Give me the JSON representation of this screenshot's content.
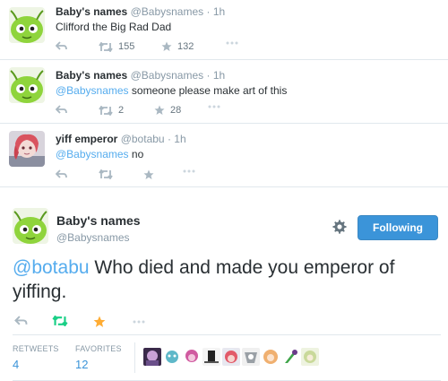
{
  "tweets": [
    {
      "name": "Baby's names",
      "handle": "@Babysnames",
      "dot": "·",
      "time": "1h",
      "mention": "",
      "text": "Clifford the Big Rad Dad",
      "retweets": "155",
      "favorites": "132"
    },
    {
      "name": "Baby's names",
      "handle": "@Babysnames",
      "dot": "·",
      "time": "1h",
      "mention": "@Babysnames",
      "text": " someone please make art of this",
      "retweets": "2",
      "favorites": "28"
    },
    {
      "name": "yiff emperor",
      "handle": "@botabu",
      "dot": "·",
      "time": "1h",
      "mention": "@Babysnames",
      "text": " no",
      "retweets": "",
      "favorites": ""
    }
  ],
  "main": {
    "name": "Baby's names",
    "handle": "@Babysnames",
    "follow_label": "Following",
    "mention": "@botabu",
    "text": " Who died and made you emperor of yiffing.",
    "retweets_label": "RETWEETS",
    "retweets": "4",
    "favorites_label": "FAVORITES",
    "favorites": "12"
  },
  "icons": {
    "reply": "reply-icon",
    "retweet": "retweet-icon",
    "favorite": "star-icon",
    "more": "more-icon",
    "gear": "gear-icon"
  },
  "colors": {
    "link": "#55acee",
    "follow_button": "#3b94d9",
    "retweet_active": "#19cf86",
    "favorite_active": "#ffac33",
    "muted": "#8899a6"
  }
}
